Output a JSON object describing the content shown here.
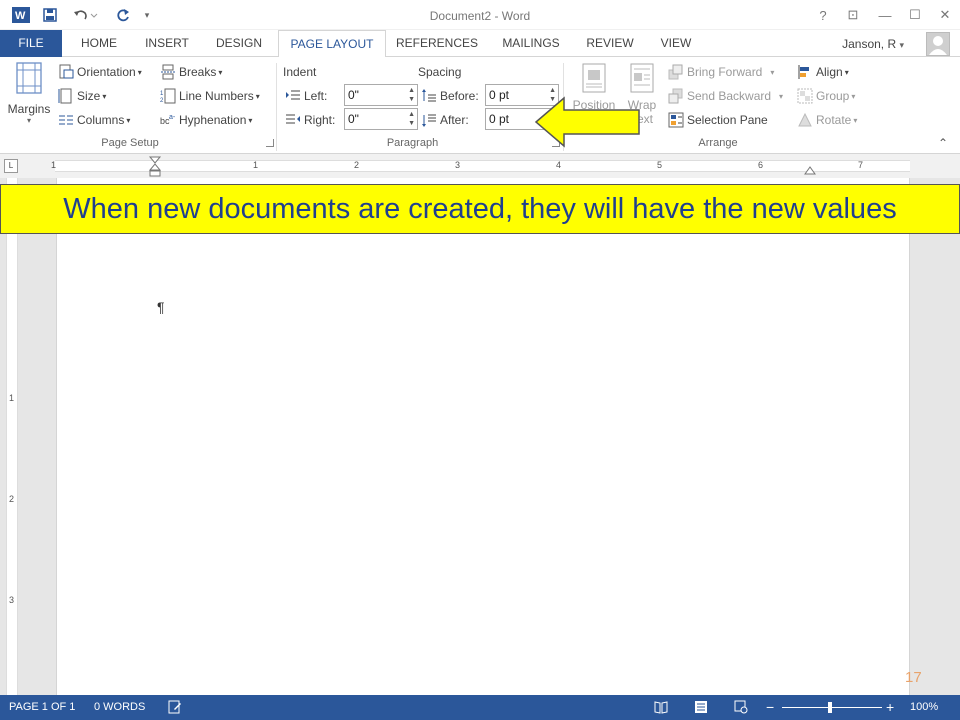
{
  "title_bar": {
    "title": "Document2 - Word",
    "help": "?",
    "ribbon_display": "⊡",
    "minimize": "—",
    "restore": "☐",
    "close": "✕"
  },
  "tabs": {
    "file": "FILE",
    "items": [
      "HOME",
      "INSERT",
      "DESIGN",
      "PAGE LAYOUT",
      "REFERENCES",
      "MAILINGS",
      "REVIEW",
      "VIEW"
    ],
    "active": "PAGE LAYOUT",
    "user": "Janson, R",
    "user_caret": "▾"
  },
  "ribbon": {
    "page_setup": {
      "label": "Page Setup",
      "margins": "Margins",
      "orientation": "Orientation",
      "size": "Size",
      "columns": "Columns",
      "breaks": "Breaks",
      "line_numbers": "Line Numbers",
      "hyphenation": "Hyphenation"
    },
    "paragraph": {
      "label": "Paragraph",
      "indent_label": "Indent",
      "left_label": "Left:",
      "left_value": "0\"",
      "right_label": "Right:",
      "right_value": "0\"",
      "spacing_label": "Spacing",
      "before_label": "Before:",
      "before_value": "0 pt",
      "after_label": "After:",
      "after_value": "0 pt"
    },
    "arrange": {
      "label": "Arrange",
      "position": "Position",
      "wrap": "Wrap",
      "wrap_text": "Text",
      "bring_forward": "Bring Forward",
      "send_backward": "Send Backward",
      "selection_pane": "Selection Pane",
      "align": "Align",
      "group": "Group",
      "rotate": "Rotate"
    },
    "collapse": "⌃"
  },
  "ruler": {
    "tab_selector": "L",
    "numbers": [
      "1",
      "1",
      "2",
      "3",
      "4",
      "5",
      "6",
      "7"
    ]
  },
  "vertical_ruler": {
    "numbers": [
      "1",
      "2",
      "3"
    ]
  },
  "document": {
    "pilcrow": "¶"
  },
  "callout": {
    "text": "When new documents are created, they will have the new values"
  },
  "slide_number": "17",
  "status_bar": {
    "page": "PAGE 1 OF 1",
    "words": "0 WORDS",
    "zoom": "100%",
    "zoom_minus": "−",
    "zoom_plus": "+"
  },
  "colors": {
    "accent": "#2b579a",
    "callout_bg": "#ffff00",
    "callout_text": "#1f3f8f",
    "slide_number": "#e8a36b"
  }
}
